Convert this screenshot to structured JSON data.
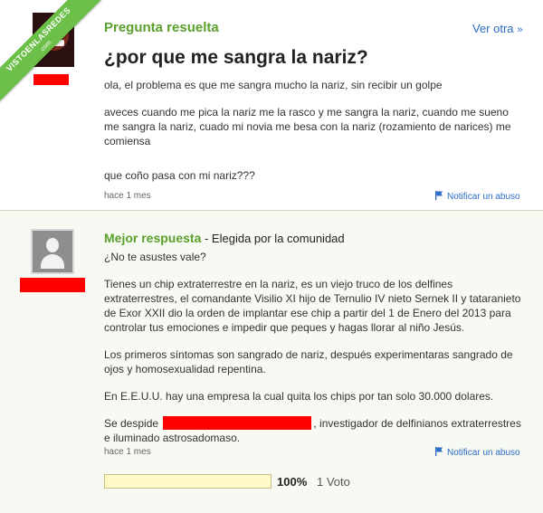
{
  "question": {
    "status": "Pregunta resuelta",
    "nav_label": "Ver otra",
    "title": "¿por que me sangra la nariz?",
    "paragraphs": [
      "ola, el problema es que me sangra mucho la nariz, sin recibir un golpe",
      "aveces cuando me pica la nariz me la rasco y me sangra la nariz, cuando me sueno me sangra la nariz, cuado mi novia me besa con la nariz (rozamiento de narices) me comiensa",
      "que coño pasa con mi nariz???"
    ],
    "time": "hace 1 mes",
    "report_label": "Notificar un abuso"
  },
  "answer": {
    "best_label": "Mejor respuesta",
    "chosen_by": " - Elegida por la comunidad",
    "paragraphs": [
      "¿No te asustes vale?",
      "Tienes un chip extraterrestre en la nariz, es un viejo truco de los delfines extraterrestres, el comandante Visilio XI hijo de Ternulio IV nieto Sernek II y tataranieto de Exor XXII dio la orden de implantar ese chip a partir del 1 de Enero del 2013 para controlar tus emociones e impedir que peques y hagas llorar al niño Jesús.",
      "Los primeros síntomas son sangrado de nariz, después experimentaras sangrado de ojos y homosexualidad repentina.",
      "En E.E.U.U. hay una empresa la cual quita los chips por tan solo 30.000 dolares."
    ],
    "signoff_prefix": "Se despide",
    "signoff_suffix": ", investigador de delfinianos extraterrestres e iluminado astrosadomaso.",
    "time": "hace 1 mes",
    "report_label": "Notificar un abuso",
    "vote_percent_value": 1.0,
    "vote_percent": "100%",
    "vote_count": "1 Voto"
  },
  "watermark": {
    "main": "VISTOENLASREDES",
    "sub": ".com"
  },
  "colors": {
    "accent_green": "#5aa02c",
    "link_blue": "#2b6cc8",
    "redaction_red": "#ff0000",
    "vote_bar_fill": "#fff9c8"
  },
  "icons": {
    "nav": "chevron-right-icon",
    "report": "flag-icon",
    "default_avatar": "user-silhouette-icon"
  }
}
